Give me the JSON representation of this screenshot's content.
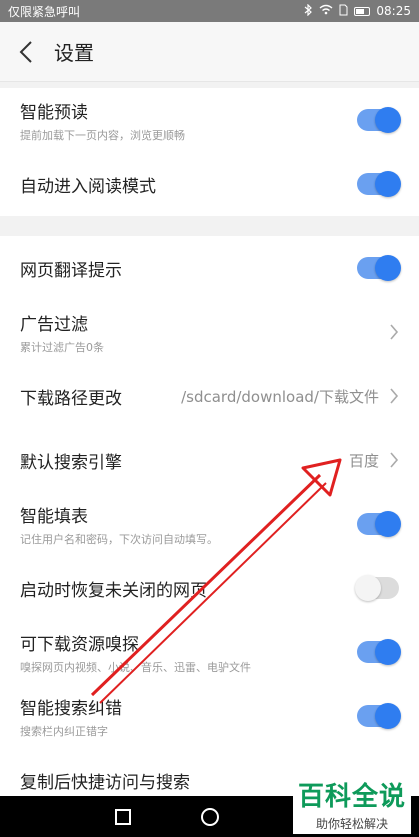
{
  "status_bar": {
    "left_text": "仅限紧急呼叫",
    "time": "08:25"
  },
  "header": {
    "title": "设置"
  },
  "section1": [
    {
      "title": "智能预读",
      "subtitle": "提前加载下一页内容，浏览更顺畅",
      "toggle": "on"
    },
    {
      "title": "自动进入阅读模式",
      "toggle": "on"
    }
  ],
  "section2": [
    {
      "title": "网页翻译提示",
      "toggle": "on"
    },
    {
      "title": "广告过滤",
      "subtitle": "累计过滤广告0条",
      "chevron": true
    },
    {
      "title": "下载路径更改",
      "value": "/sdcard/download/下载文件",
      "chevron": true
    },
    {
      "title": "默认搜索引擎",
      "value": "百度",
      "chevron": true
    },
    {
      "title": "智能填表",
      "subtitle": "记住用户名和密码，下次访问自动填写。",
      "toggle": "on"
    },
    {
      "title": "启动时恢复未关闭的网页",
      "toggle": "off"
    },
    {
      "title": "可下载资源嗅探",
      "subtitle": "嗅探网页内视频、小说、音乐、迅雷、电驴文件",
      "toggle": "on"
    },
    {
      "title": "智能搜索纠错",
      "subtitle": "搜索栏内纠正错字",
      "toggle": "on"
    },
    {
      "title": "复制后快捷访问与搜索"
    }
  ],
  "watermark": {
    "main": "百科全说",
    "sub": "助你轻松解决"
  },
  "colors": {
    "toggle_on": "#2f7df0",
    "arrow": "#e02020",
    "watermark": "#0e9a5a"
  }
}
